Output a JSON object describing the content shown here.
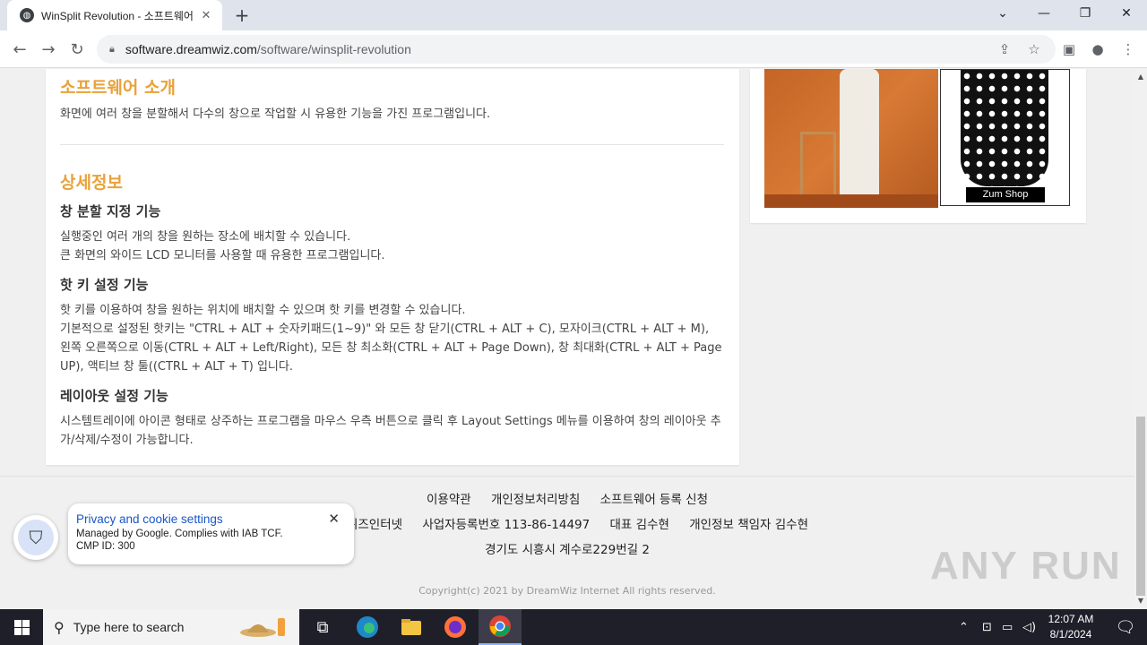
{
  "browser": {
    "tab_title": "WinSplit Revolution - 소프트웨어",
    "tab_close": "✕",
    "new_tab": "+",
    "url_host": "software.dreamwiz.com",
    "url_path": "/software/winsplit-revolution",
    "window_controls": {
      "list": "⌄",
      "minimize": "—",
      "restore": "❐",
      "close": "✕"
    }
  },
  "content": {
    "intro_title": "소프트웨어 소개",
    "intro_text": "화면에 여러 창을 분할해서 다수의 창으로 작업할 시 유용한 기능을 가진 프로그램입니다.",
    "detail_title": "상세정보",
    "sections": [
      {
        "heading": "창 분할 지정 기능",
        "lines": [
          "실행중인 여러 개의 창을 원하는 장소에 배치할 수 있습니다.",
          "큰 화면의 와이드 LCD 모니터를 사용할 때 유용한 프로그램입니다."
        ]
      },
      {
        "heading": "핫 키 설정 기능",
        "lines": [
          "핫 키를 이용하여 창을 원하는 위치에 배치할 수 있으며 핫 키를 변경할 수 있습니다.",
          "기본적으로 설정된 핫키는 \"CTRL + ALT + 숫자키패드(1~9)\" 와 모든 창 닫기(CTRL + ALT + C), 모자이크(CTRL + ALT + M), 왼쪽 오른쪽으로 이동(CTRL + ALT + Left/Right), 모든 창 최소화(CTRL + ALT + Page Down), 창 최대화(CTRL + ALT + Page UP), 액티브 창 툴((CTRL + ALT + T) 입니다."
        ]
      },
      {
        "heading": "레이아웃 설정 기능",
        "lines": [
          "시스템트레이에 아이콘 형태로 상주하는 프로그램을 마우스 우측 버튼으로 클릭 후 Layout Settings 메뉴를 이용하여 창의 레이아웃 추가/삭제/수정이 가능합니다."
        ]
      }
    ]
  },
  "ad": {
    "shop_label": "Zum Shop"
  },
  "footer": {
    "links": [
      "이용약관",
      "개인정보처리방침",
      "소프트웨어 등록 신청"
    ],
    "info": [
      "(주)위즈인터넷",
      "사업자등록번호 113-86-14497",
      "대표 김수현",
      "개인정보 책임자 김수현"
    ],
    "address": "경기도 시흥시 계수로229번길 2",
    "copyright": "Copyright(c) 2021 by DreamWiz Internet All rights reserved."
  },
  "privacy": {
    "title": "Privacy and cookie settings",
    "line1": "Managed by Google. Complies with IAB TCF.",
    "line2": "CMP ID: 300",
    "close": "✕"
  },
  "watermark": "ANY RUN",
  "taskbar": {
    "search_placeholder": "Type here to search",
    "time": "12:07 AM",
    "date": "8/1/2024"
  },
  "colors": {
    "accent": "#e8a23a",
    "link_blue": "#1a56c8",
    "taskbar": "#1f1f2a"
  }
}
